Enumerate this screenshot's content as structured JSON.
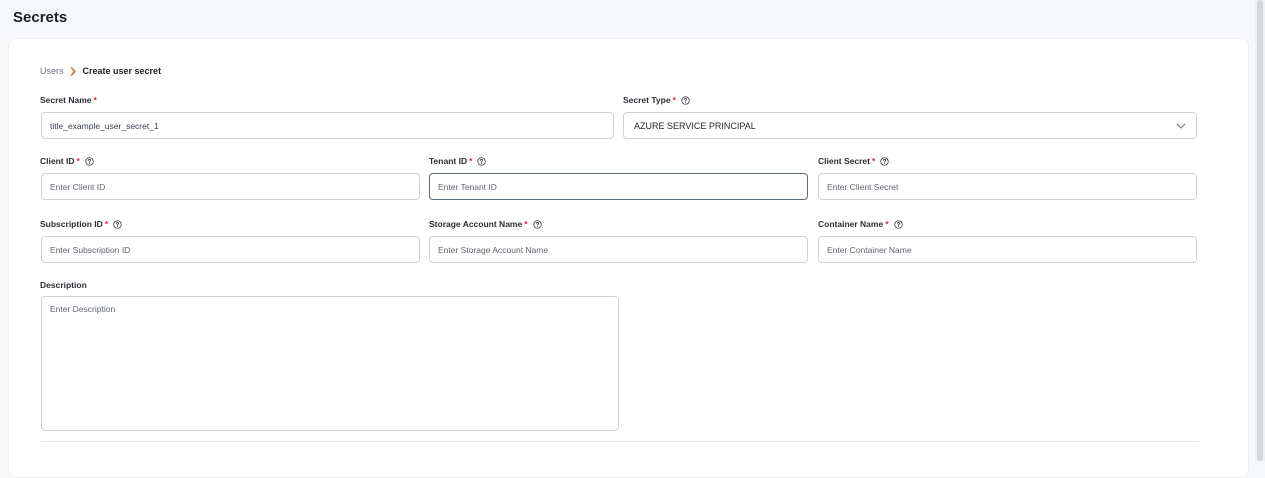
{
  "page": {
    "title": "Secrets"
  },
  "breadcrumb": {
    "parent": "Users",
    "current": "Create user secret"
  },
  "form": {
    "secret_name": {
      "label": "Secret Name",
      "required": "*",
      "value": "title_example_user_secret_1"
    },
    "secret_type": {
      "label": "Secret Type",
      "required": "*",
      "selected": "AZURE SERVICE PRINCIPAL"
    },
    "client_id": {
      "label": "Client ID",
      "required": "*",
      "placeholder": "Enter Client ID"
    },
    "tenant_id": {
      "label": "Tenant ID",
      "required": "*",
      "placeholder": "Enter Tenant ID"
    },
    "client_secret": {
      "label": "Client Secret",
      "required": "*",
      "placeholder": "Enter Client Secret"
    },
    "subscription_id": {
      "label": "Subscription ID",
      "required": "*",
      "placeholder": "Enter Subscription ID"
    },
    "storage_account_name": {
      "label": "Storage Account Name",
      "required": "*",
      "placeholder": "Enter Storage Account Name"
    },
    "container_name": {
      "label": "Container Name",
      "required": "*",
      "placeholder": "Enter Container Name"
    },
    "description": {
      "label": "Description",
      "placeholder": "Enter Description"
    }
  },
  "icons": {
    "breadcrumb_separator": "chevron-right-icon",
    "help": "question-circle-icon",
    "dropdown": "chevron-down-icon"
  },
  "colors": {
    "accent": "#e0602a",
    "required": "#e02424",
    "border": "#cfd3d8",
    "focused_border": "#5b6b7e"
  }
}
